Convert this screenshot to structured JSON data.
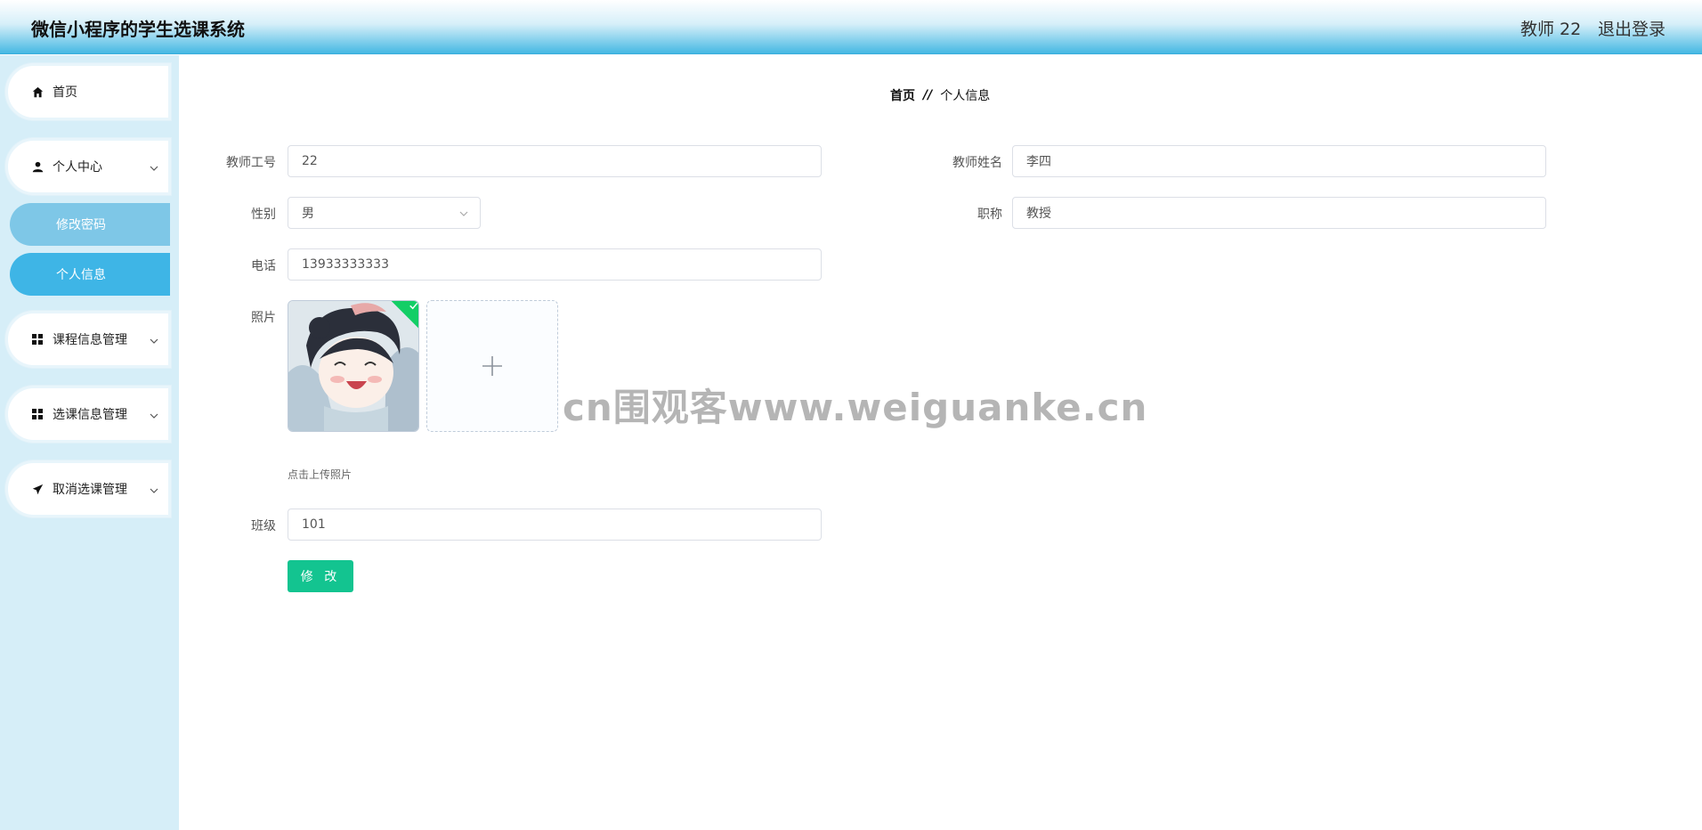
{
  "header": {
    "app_title": "微信小程序的学生选课系统",
    "user_label": "教师 22",
    "logout_label": "退出登录"
  },
  "sidebar": {
    "items": [
      {
        "label": "首页",
        "icon": "home-icon"
      },
      {
        "label": "个人中心",
        "icon": "user-icon",
        "expanded": true,
        "children": [
          {
            "label": "修改密码"
          },
          {
            "label": "个人信息",
            "active": true
          }
        ]
      },
      {
        "label": "课程信息管理",
        "icon": "grid-icon"
      },
      {
        "label": "选课信息管理",
        "icon": "grid-icon"
      },
      {
        "label": "取消选课管理",
        "icon": "paper-plane-icon"
      }
    ]
  },
  "breadcrumb": {
    "home": "首页",
    "separator": "//",
    "current": "个人信息"
  },
  "form": {
    "teacher_id": {
      "label": "教师工号",
      "value": "22"
    },
    "teacher_name": {
      "label": "教师姓名",
      "value": "李四"
    },
    "gender": {
      "label": "性别",
      "value": "男"
    },
    "title": {
      "label": "职称",
      "value": "教授"
    },
    "phone": {
      "label": "电话",
      "value": "13933333333"
    },
    "photo": {
      "label": "照片",
      "hint": "点击上传照片"
    },
    "class": {
      "label": "班级",
      "value": "101"
    },
    "submit_label": "修 改"
  },
  "watermark": "cn围观客www.weiguanke.cn",
  "colors": {
    "accent": "#3eb5e6",
    "submit": "#13c490",
    "success": "#13ce66"
  }
}
